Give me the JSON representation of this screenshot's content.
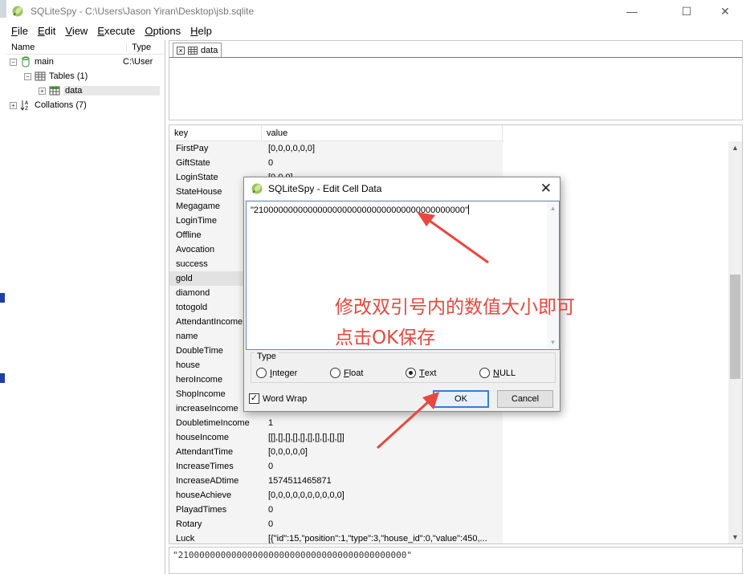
{
  "window": {
    "title": "SQLiteSpy - C:\\Users\\Jason Yiran\\Desktop\\jsb.sqlite",
    "minimize_glyph": "—",
    "maximize_glyph": "☐",
    "close_glyph": "✕"
  },
  "menu": [
    {
      "key": "F",
      "rest": "ile"
    },
    {
      "key": "E",
      "rest": "dit"
    },
    {
      "key": "V",
      "rest": "iew"
    },
    {
      "key": "E",
      "rest": "xecute"
    },
    {
      "key": "O",
      "rest": "ptions"
    },
    {
      "key": "H",
      "rest": "elp"
    }
  ],
  "tree": {
    "col_name": "Name",
    "col_type": "Type",
    "main_label": "main",
    "main_type": "C:\\User",
    "tables_label": "Tables (1)",
    "data_label": "data",
    "collations_label": "Collations (7)"
  },
  "tab": {
    "label": "data"
  },
  "grid": {
    "col_key": "key",
    "col_value": "value",
    "rows": [
      {
        "k": "FirstPay",
        "v": "[0,0,0,0,0,0]"
      },
      {
        "k": "GiftState",
        "v": "0"
      },
      {
        "k": "LoginState",
        "v": "[0,0,0]"
      },
      {
        "k": "StateHouse",
        "v": ""
      },
      {
        "k": "Megagame",
        "v": ""
      },
      {
        "k": "LoginTime",
        "v": ""
      },
      {
        "k": "Offline",
        "v": ""
      },
      {
        "k": "Avocation",
        "v": ""
      },
      {
        "k": "success",
        "v": ""
      },
      {
        "k": "gold",
        "v": ""
      },
      {
        "k": "diamond",
        "v": ""
      },
      {
        "k": "totogold",
        "v": ""
      },
      {
        "k": "AttendantIncome",
        "v": ""
      },
      {
        "k": "name",
        "v": ""
      },
      {
        "k": "DoubleTime",
        "v": ""
      },
      {
        "k": "house",
        "v": ""
      },
      {
        "k": "heroIncome",
        "v": ""
      },
      {
        "k": "ShopIncome",
        "v": ""
      },
      {
        "k": "increaseIncome",
        "v": ""
      },
      {
        "k": "DoubletimeIncome",
        "v": "1"
      },
      {
        "k": "houseIncome",
        "v": "[[],[],[],[],[],[],[],[],[],[]]"
      },
      {
        "k": "AttendantTime",
        "v": "[0,0,0,0,0]"
      },
      {
        "k": "IncreaseTimes",
        "v": "0"
      },
      {
        "k": "IncreaseADtime",
        "v": "1574511465871"
      },
      {
        "k": "houseAchieve",
        "v": "[0,0,0,0,0,0,0,0,0,0]"
      },
      {
        "k": "PlayadTimes",
        "v": "0"
      },
      {
        "k": "Rotary",
        "v": "0"
      },
      {
        "k": "Luck",
        "v": "[{\"id\":15,\"position\":1,\"type\":3,\"house_id\":0,\"value\":450,..."
      }
    ]
  },
  "preview_text": "\"2100000000000000000000000000000000000000000\"",
  "dialog": {
    "title": "SQLiteSpy - Edit Cell Data",
    "value": "\"2100000000000000000000000000000000000000000\"",
    "annotation_line1": "修改双引号内的数值大小即可",
    "annotation_line2": "点击OK保存",
    "type_legend": "Type",
    "radios": [
      {
        "key": "I",
        "rest": "nteger",
        "checked": false
      },
      {
        "key": "F",
        "rest": "loat",
        "checked": false
      },
      {
        "key": "T",
        "rest": "ext",
        "checked": true
      },
      {
        "key": "N",
        "rest": "ULL",
        "checked": false
      }
    ],
    "word_wrap_label": "Word Wrap",
    "word_wrap_checked": true,
    "ok_label": "OK",
    "cancel_label": "Cancel"
  },
  "colors": {
    "annotation": "#e8473d",
    "ok_border": "#3b7bd6"
  },
  "icons": {
    "app": "sqlitespy-feather-icon",
    "database": "database-icon",
    "tables": "tables-icon",
    "table": "table-icon",
    "collations": "sort-az-icon"
  }
}
